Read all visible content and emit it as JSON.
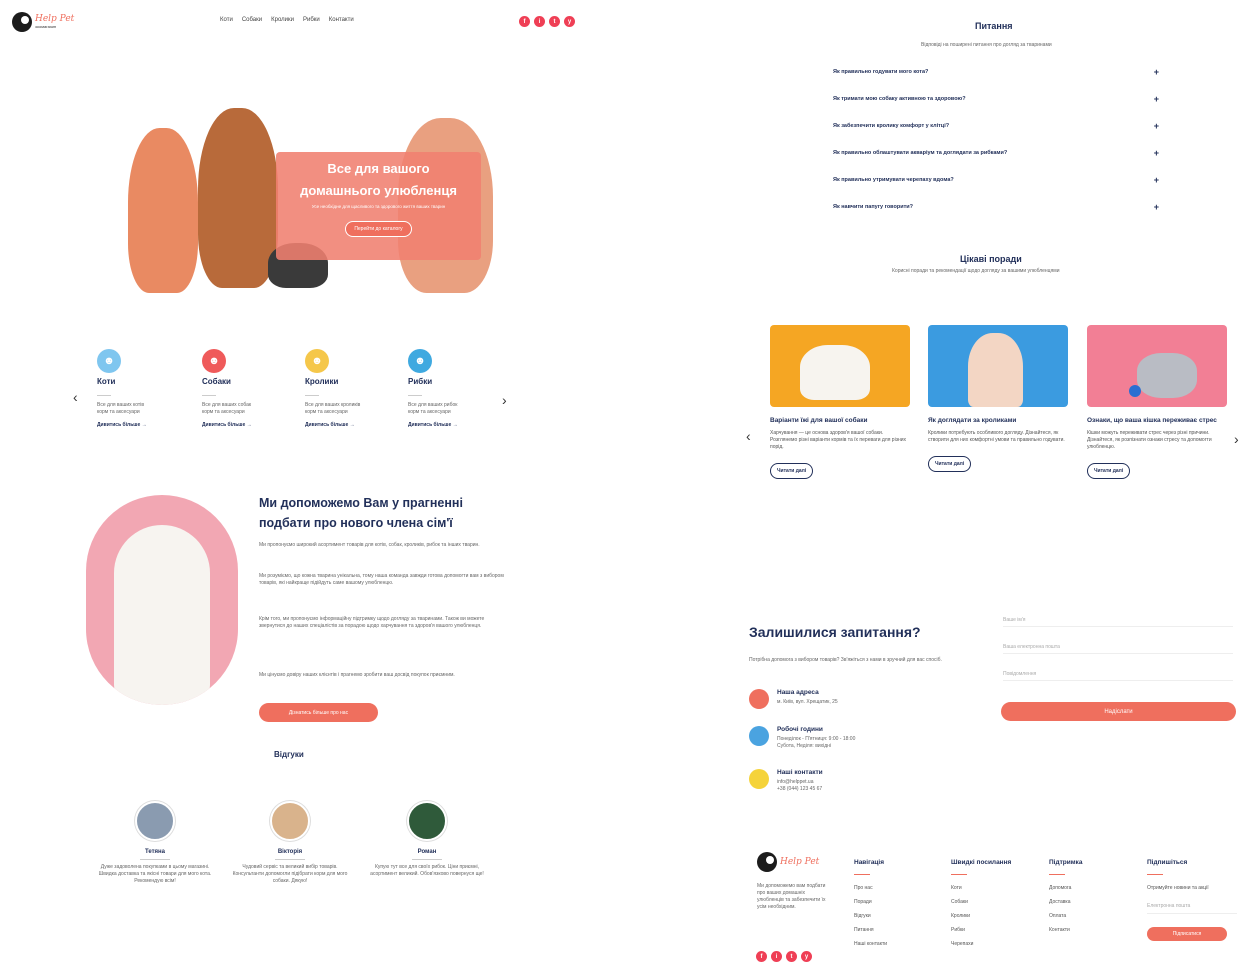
{
  "header": {
    "logo_name": "Help Pet",
    "logo_sub": "зоомагазин",
    "nav": [
      "Коти",
      "Собаки",
      "Кролики",
      "Рибки",
      "Контакти"
    ],
    "socials": [
      "f",
      "i",
      "t",
      "y"
    ]
  },
  "hero": {
    "title_line1": "Все для вашого",
    "title_line2": "домашнього улюбленця",
    "subtitle": "Усе необхідне для щасливого та здорового життя ваших тварин",
    "button": "Перейти до каталогу"
  },
  "categories": [
    {
      "title": "Коти",
      "text1": "Все для ваших котів",
      "text2": "корм та аксесуари",
      "link": "Дивитись більше →",
      "color": "#7fc6ef",
      "glyph": "☻"
    },
    {
      "title": "Собаки",
      "text1": "Все для ваших собак",
      "text2": "корм та аксесуари",
      "link": "Дивитись більше →",
      "color": "#ef5a5a",
      "glyph": "☻"
    },
    {
      "title": "Кролики",
      "text1": "Все для ваших кроликів",
      "text2": "корм та аксесуари",
      "link": "Дивитись більше →",
      "color": "#f5c74a",
      "glyph": "☻"
    },
    {
      "title": "Рибки",
      "text1": "Все для ваших рибок",
      "text2": "корм та аксесуари",
      "link": "Дивитись більше →",
      "color": "#3fa9e0",
      "glyph": "☻"
    }
  ],
  "about": {
    "title": "Ми допоможемо Вам у прагненні подбати про нового члена сім'ї",
    "p1": "Ми пропонуємо широкий асортимент товарів для котів, собак, кроликів, рибок та інших тварин.",
    "p2": "Ми розуміємо, що кожна тварина унікальна, тому наша команда завжди готова допомогти вам з вибором товарів, які найкраще підійдуть саме вашому улюбленцю.",
    "p3": "Крім того, ми пропонуємо інформаційну підтримку щодо догляду за тваринами. Також ви можете звернутися до наших спеціалістів за порадою щодо харчування та здоров'я вашого улюбленця.",
    "p4": "Ми цінуємо довіру наших клієнтів і прагнемо зробити ваш досвід покупок приємним.",
    "button": "Дізнатись більше про нас"
  },
  "reviews": {
    "title": "Відгуки",
    "items": [
      {
        "name": "Тетяна",
        "text": "Дуже задоволена покупками в цьому магазині. Швидка доставка та якісні товари для мого кота. Рекомендую всім!",
        "avatar_color": "#8a9bb0"
      },
      {
        "name": "Вікторія",
        "text": "Чудовий сервіс та великий вибір товарів. Консультанти допомогли підібрати корм для мого собаки. Дякую!",
        "avatar_color": "#d9b38c"
      },
      {
        "name": "Роман",
        "text": "Купую тут все для своїх рибок. Ціни приємні, асортимент великий. Обов'язково повернуся ще!",
        "avatar_color": "#2f5a3a"
      }
    ]
  },
  "faq": {
    "title": "Питання",
    "subtitle": "Відповіді на поширені питання про догляд за тваринами",
    "items": [
      "Як правильно годувати мого кота?",
      "Як тримати мою собаку активною та здоровою?",
      "Як забезпечити кролику комфорт у клітці?",
      "Як правильно облаштувати акваріум та доглядати за рибками?",
      "Як правильно утримувати черепаху вдома?",
      "Як навчити папугу говорити?"
    ]
  },
  "tips": {
    "title": "Цікаві поради",
    "subtitle": "Корисні поради та рекомендації щодо догляду за вашими улюбленцями",
    "items": [
      {
        "title": "Варіанти їжі для вашої собаки",
        "text": "Харчування — це основа здоров'я вашої собаки. Розглянемо різні варіанти кормів та їх переваги для різних порід.",
        "button": "Читати далі",
        "bg": "#f5a623"
      },
      {
        "title": "Як доглядати за кроликами",
        "text": "Кролики потребують особливого догляду. Дізнайтеся, як створити для них комфортні умови та правильно годувати.",
        "button": "Читати далі",
        "bg": "#3b9be0"
      },
      {
        "title": "Ознаки, що ваша кішка переживає стрес",
        "text": "Кішки можуть переживати стрес через різні причини. Дізнайтеся, як розпізнати ознаки стресу та допомогти улюбленцю.",
        "button": "Читати далі",
        "bg": "#f27f95"
      }
    ]
  },
  "contact": {
    "title": "Залишилися запитання?",
    "subtitle": "Потрібна допомога з вибором товарів? Зв'яжіться з нами в зручний для вас спосіб.",
    "items": [
      {
        "title": "Наша адреса",
        "line1": "м. Київ, вул. Хрещатик, 25",
        "line2": "",
        "color": "#ef6f5e"
      },
      {
        "title": "Робочі години",
        "line1": "Понеділок - П'ятниця: 9:00 - 18:00",
        "line2": "Субота, Неділя: вихідні",
        "color": "#4aa3e0"
      },
      {
        "title": "Наші контакти",
        "line1": "info@helppet.ua",
        "line2": "+38 (044) 123 45 67",
        "color": "#f5d33a"
      }
    ],
    "fields": [
      "Ваше ім'я",
      "Ваша електронна пошта",
      "Повідомлення"
    ],
    "button": "Надіслати"
  },
  "footer": {
    "logo_name": "Help Pet",
    "about": "Ми допоможемо вам подбати про ваших домашніх улюбленців та забезпечити їх усім необхідним.",
    "columns": [
      {
        "title": "Навігація",
        "items": [
          "Про нас",
          "Поради",
          "Відгуки",
          "Питання",
          "Наші контакти"
        ]
      },
      {
        "title": "Швидкі посилання",
        "items": [
          "Коти",
          "Собаки",
          "Кролики",
          "Рибки",
          "Черепахи"
        ]
      },
      {
        "title": "Підтримка",
        "items": [
          "Допомога",
          "Доставка",
          "Оплата",
          "Контакти"
        ]
      }
    ],
    "subscribe": {
      "title": "Підпишіться",
      "text": "Отримуйте новини та акції",
      "placeholder": "Електронна пошта",
      "button": "Підписатися"
    }
  },
  "colors": {
    "accent": "#ef6f5e",
    "navy": "#22305a",
    "social": "#ef3f55"
  }
}
